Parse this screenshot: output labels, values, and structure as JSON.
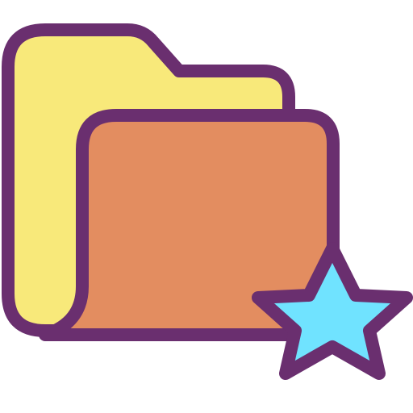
{
  "icon": {
    "name": "favorite-folder-icon",
    "colors": {
      "outline": "#6a2f6f",
      "folder_back": "#f8e97a",
      "folder_front": "#e38d60",
      "star": "#70e3ff"
    }
  }
}
